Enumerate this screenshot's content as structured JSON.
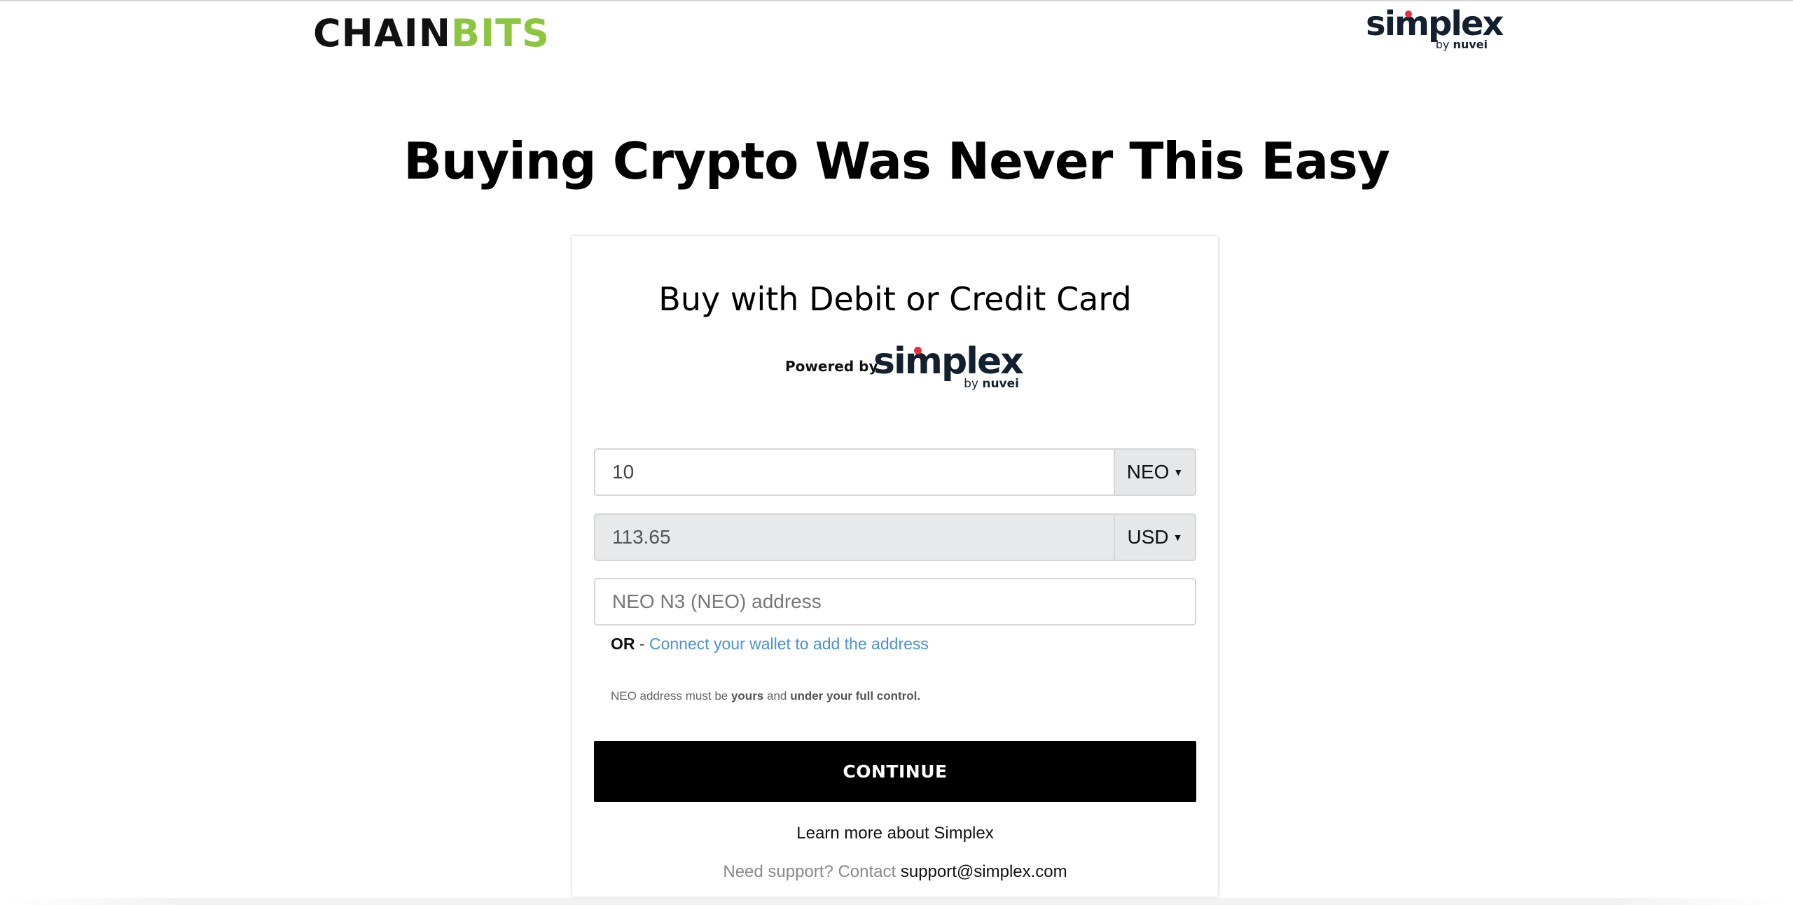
{
  "header": {
    "brand_part1": "CHAIN",
    "brand_part2": "BITS",
    "partner_logo_word": "simplex",
    "partner_logo_by": "by",
    "partner_logo_company": "nuvei"
  },
  "hero": {
    "title": "Buying Crypto Was Never This Easy"
  },
  "card": {
    "title": "Buy with Debit or Credit Card",
    "powered_by": "Powered by",
    "logo_word": "simplex",
    "logo_by": "by",
    "logo_company": "nuvei",
    "crypto_amount": "10",
    "crypto_currency": "NEO",
    "fiat_amount": "113.65",
    "fiat_currency": "USD",
    "address_placeholder": "NEO N3 (NEO) address",
    "or_label": "OR",
    "or_separator": " - ",
    "connect_wallet_link": "Connect your wallet to add the address",
    "disclaimer_part1": "NEO address must be ",
    "disclaimer_bold1": "yours",
    "disclaimer_part2": " and ",
    "disclaimer_bold2": "under your full control.",
    "continue_label": "CONTINUE",
    "learn_more": "Learn more about Simplex",
    "support_text": "Need support? Contact ",
    "support_email": "support@simplex.com"
  },
  "colors": {
    "brand_green": "#8cc63f",
    "simplex_navy": "#13212e",
    "simplex_red": "#e0313c",
    "link_blue": "#4a90d9",
    "button_black": "#000000"
  }
}
